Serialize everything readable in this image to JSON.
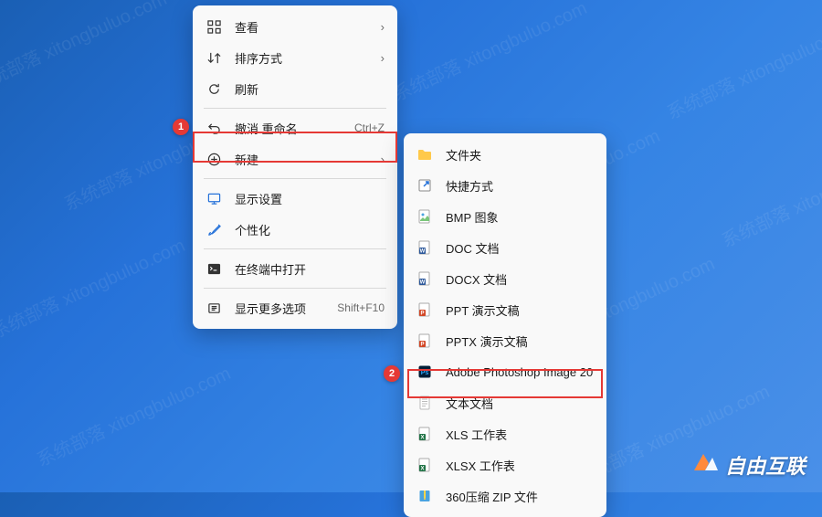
{
  "watermark_text": "系统部落 xitongbuluo.com",
  "menu1": {
    "view": "查看",
    "sort": "排序方式",
    "refresh": "刷新",
    "undo": "撤消 重命名",
    "undo_shortcut": "Ctrl+Z",
    "new": "新建",
    "display": "显示设置",
    "personalize": "个性化",
    "terminal": "在终端中打开",
    "more": "显示更多选项",
    "more_shortcut": "Shift+F10"
  },
  "menu2": {
    "folder": "文件夹",
    "shortcut": "快捷方式",
    "bmp": "BMP 图象",
    "doc": "DOC 文档",
    "docx": "DOCX 文档",
    "ppt": "PPT 演示文稿",
    "pptx": "PPTX 演示文稿",
    "psd": "Adobe Photoshop Image 20",
    "txt": "文本文档",
    "xls": "XLS 工作表",
    "xlsx": "XLSX 工作表",
    "zip": "360压缩 ZIP 文件"
  },
  "badges": {
    "b1": "1",
    "b2": "2"
  },
  "brand": "自由互联",
  "colors": {
    "highlight": "#e53935",
    "folder": "#ffc94a",
    "word": "#2b579a",
    "ppt": "#d24726",
    "excel": "#217346",
    "ps": "#001e36",
    "zip": "#4aa3df"
  }
}
